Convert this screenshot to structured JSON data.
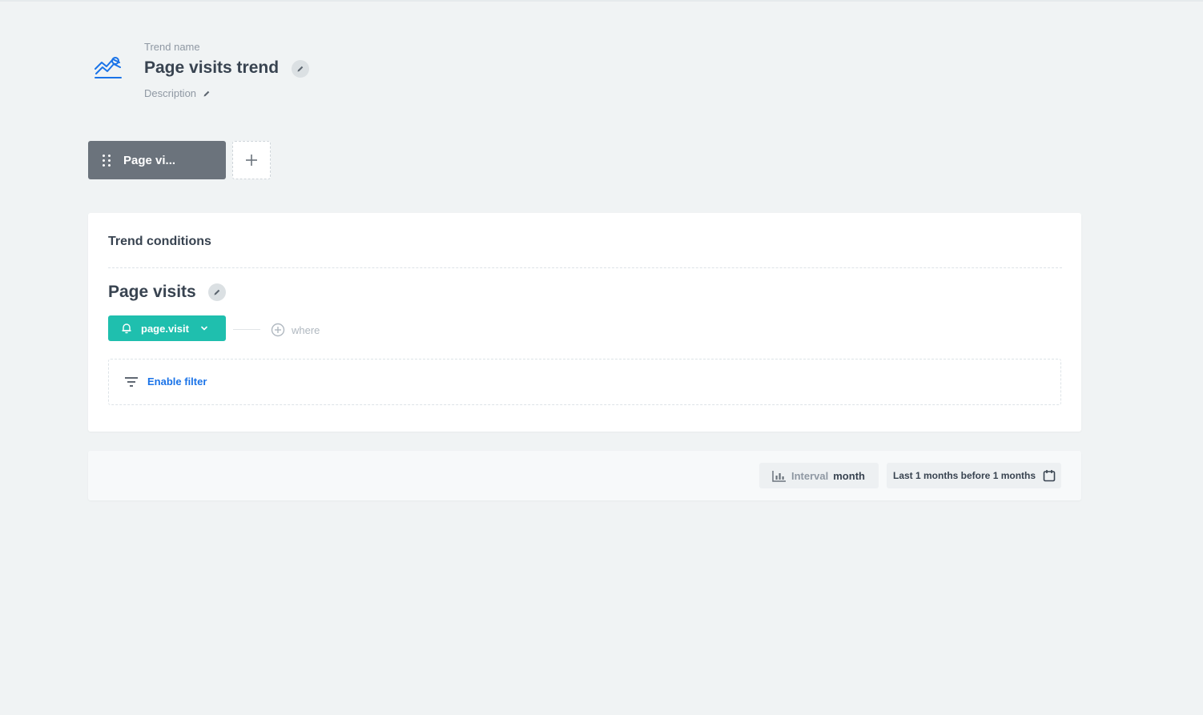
{
  "header": {
    "name_label": "Trend name",
    "title": "Page visits trend",
    "description_label": "Description",
    "icon": "trend-chart-icon",
    "accent_color": "#1a73e8"
  },
  "steps": {
    "items": [
      {
        "label": "Page vi..."
      }
    ],
    "add_icon": "plus-icon"
  },
  "conditions": {
    "title": "Trend conditions",
    "condition_name": "Page visits",
    "event": {
      "label": "page.visit",
      "color": "#1fbfae"
    },
    "where_label": "where",
    "enable_filter_label": "Enable filter"
  },
  "footer": {
    "interval_label": "Interval",
    "interval_value": "month",
    "date_range": "Last 1 months before 1 months"
  }
}
